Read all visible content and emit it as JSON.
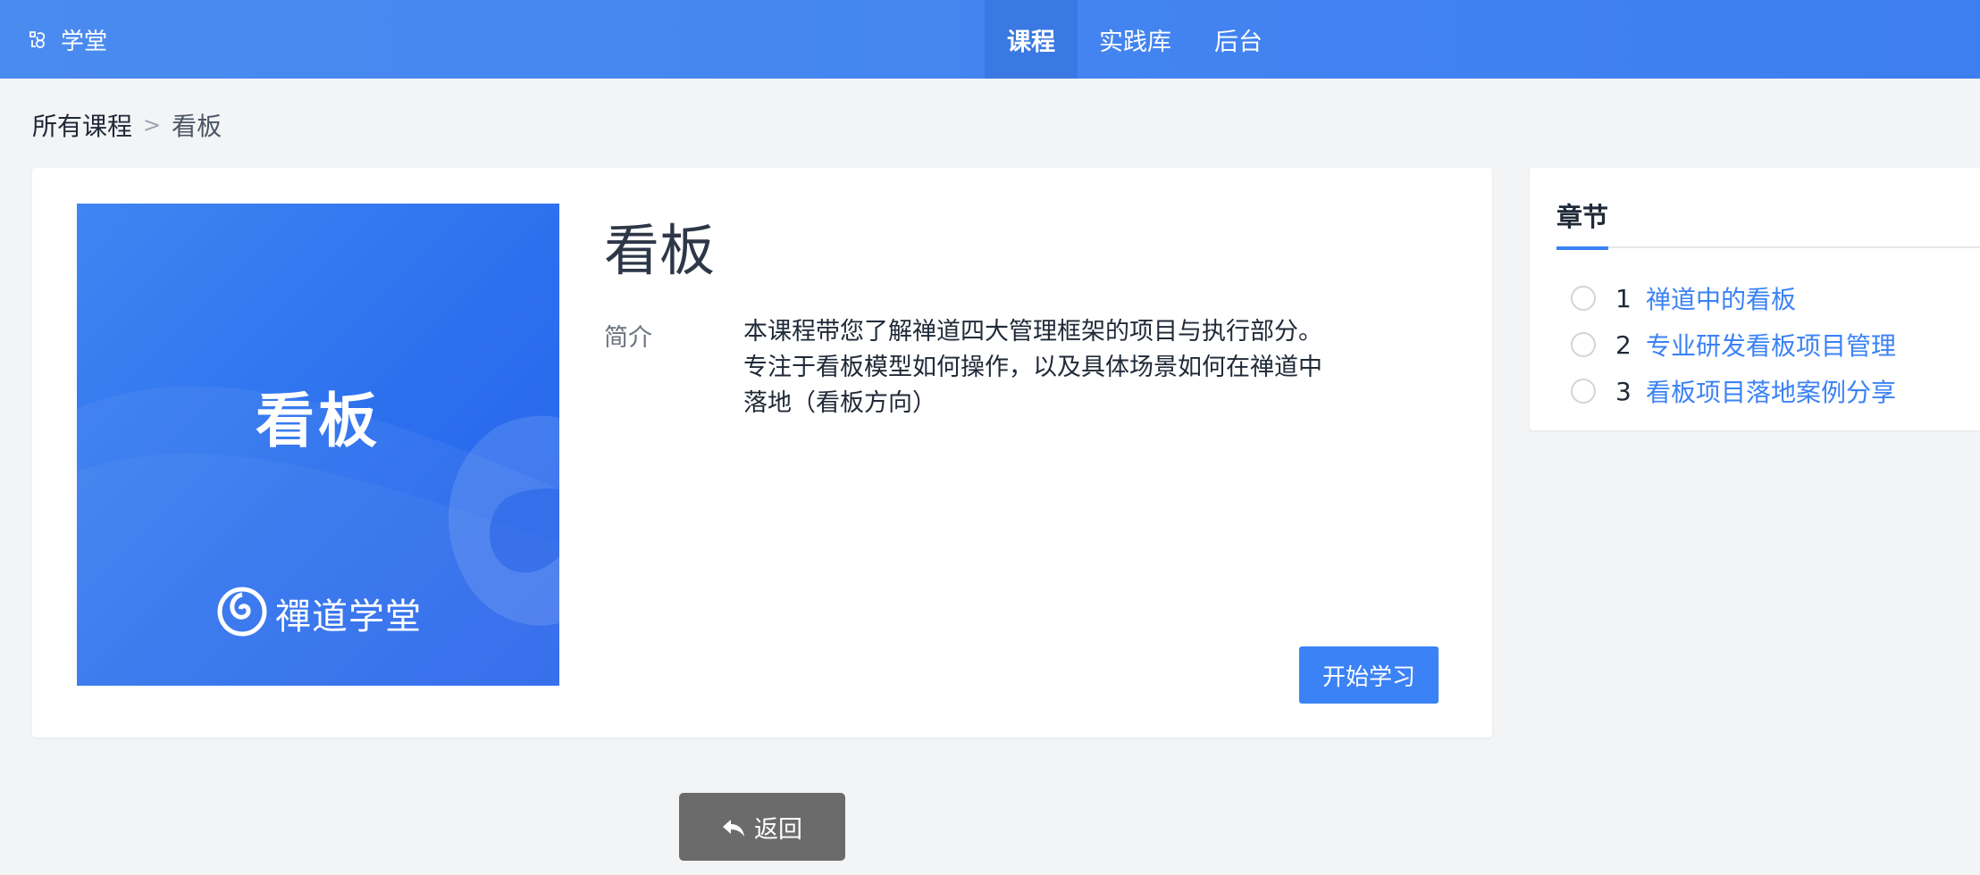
{
  "header": {
    "brand": "学堂",
    "nav": [
      {
        "label": "课程",
        "active": true
      },
      {
        "label": "实践库",
        "active": false
      },
      {
        "label": "后台",
        "active": false
      }
    ]
  },
  "breadcrumb": {
    "root": "所有课程",
    "separator": ">",
    "current": "看板"
  },
  "course": {
    "cover_title": "看板",
    "cover_logo_text": "禪道学堂",
    "title": "看板",
    "intro_label": "简介",
    "intro_text": "本课程带您了解禅道四大管理框架的项目与执行部分。专注于看板模型如何操作，以及具体场景如何在禅道中落地（看板方向）",
    "start_label": "开始学习"
  },
  "chapters": {
    "title": "章节",
    "items": [
      {
        "num": "1",
        "name": "禅道中的看板"
      },
      {
        "num": "2",
        "name": "专业研发看板项目管理"
      },
      {
        "num": "3",
        "name": "看板项目落地案例分享"
      }
    ]
  },
  "back": {
    "label": "返回"
  },
  "colors": {
    "primary": "#3b82f6",
    "topbar": "#4a8bf0",
    "back_button": "#6b6b6b"
  }
}
